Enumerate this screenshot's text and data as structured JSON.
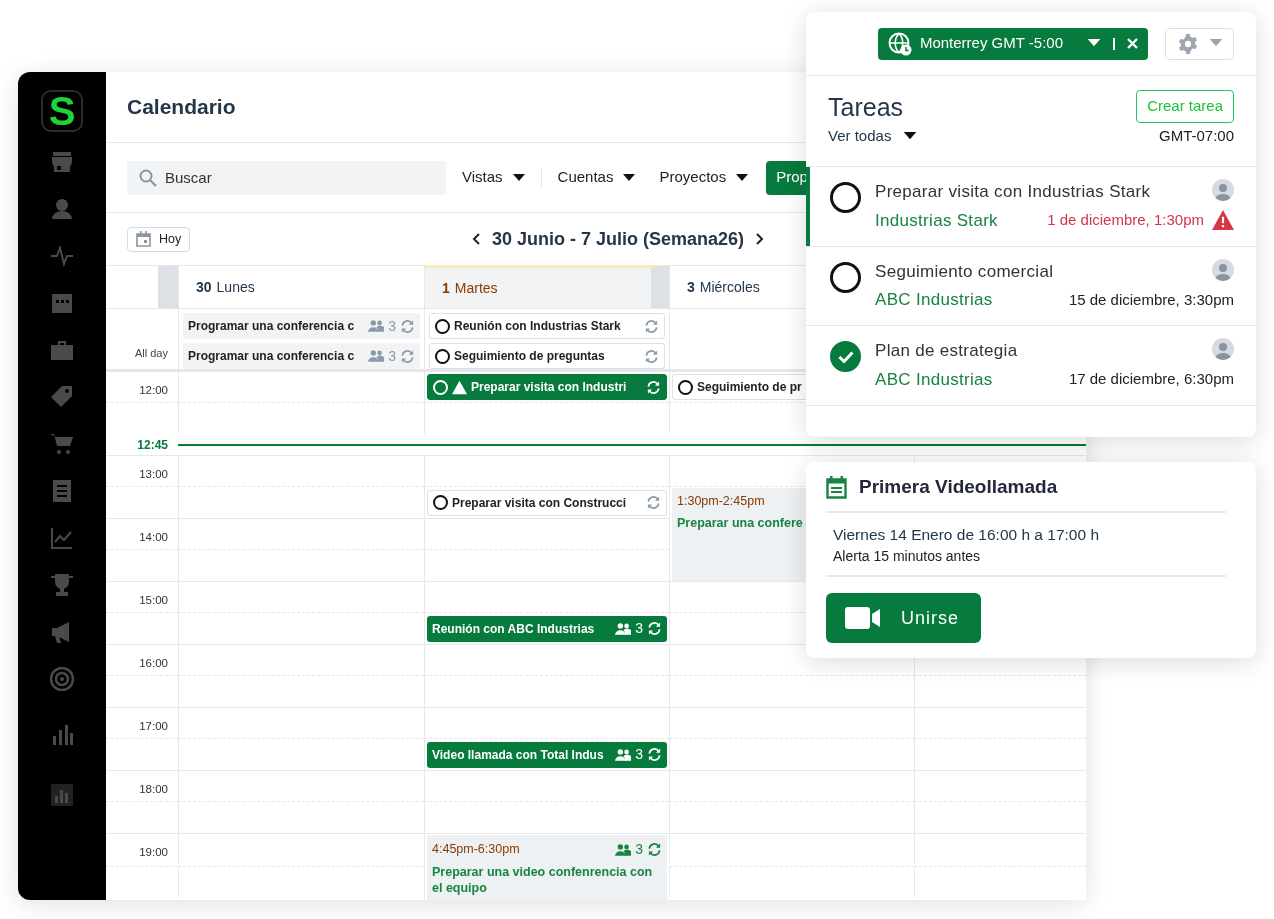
{
  "sidebar": {
    "logo": "S"
  },
  "header": {
    "title": "Calendario"
  },
  "toolbar": {
    "search": {
      "placeholder": "Buscar"
    },
    "filters": [
      "Vistas",
      "Cuentas",
      "Proyectos"
    ],
    "primary_button": "Prop"
  },
  "nav": {
    "today_button": "Hoy",
    "range": "30 Junio - 7 Julio (Semana26)"
  },
  "calendar": {
    "days": [
      {
        "number": "30",
        "name": "Lunes",
        "today": false
      },
      {
        "number": "1",
        "name": "Martes",
        "today": true
      },
      {
        "number": "3",
        "name": "Miércoles",
        "today": false
      }
    ],
    "all_day_label": "All day",
    "all_day": [
      [
        {
          "kind": "meeting",
          "title": "Programar una conferencia c",
          "highlighted": false,
          "attendees": "3",
          "recurring": true
        },
        {
          "kind": "meeting",
          "title": "Programar una conferencia c",
          "highlighted": false,
          "attendees": "3",
          "recurring": true
        }
      ],
      [
        {
          "kind": "task",
          "title": "Reunión con Industrias Stark",
          "checked": false,
          "highlighted": false,
          "warning": false,
          "recurring": true
        },
        {
          "kind": "task",
          "title": "Seguimiento de preguntas",
          "checked": false,
          "highlighted": false,
          "warning": false,
          "recurring": true
        }
      ]
    ],
    "rows": [
      {
        "kind": "hour",
        "time": "12:00",
        "cells": [
          [],
          [
            {
              "kind": "task",
              "title": "Preparar visita con Industri",
              "checked": false,
              "highlighted": true,
              "warning": true,
              "recurring": true
            }
          ],
          [
            {
              "kind": "task",
              "title": "Seguimiento de pr",
              "checked": false,
              "highlighted": false,
              "warning": false,
              "recurring": false
            }
          ]
        ]
      },
      {
        "kind": "half"
      },
      {
        "kind": "now",
        "time": "12:45"
      },
      {
        "kind": "hour",
        "time": "13:00"
      },
      {
        "kind": "half",
        "cells": [
          [],
          [
            {
              "kind": "task",
              "title": "Preparar visita con Construcci",
              "checked": false,
              "highlighted": false,
              "warning": false,
              "recurring": true
            }
          ],
          [
            {
              "kind": "block",
              "time_range": "1:30pm-2:45pm",
              "title": "Preparar una confere",
              "recurring": false
            }
          ]
        ]
      },
      {
        "kind": "hour",
        "time": "14:00"
      },
      {
        "kind": "half"
      },
      {
        "kind": "hour",
        "time": "15:00"
      },
      {
        "kind": "half",
        "cells": [
          [],
          [
            {
              "kind": "meeting",
              "title": "Reunión con ABC Industrias",
              "highlighted": true,
              "attendees": "3",
              "recurring": true
            }
          ]
        ]
      },
      {
        "kind": "hour",
        "time": "16:00"
      },
      {
        "kind": "half"
      },
      {
        "kind": "hour",
        "time": "17:00"
      },
      {
        "kind": "half",
        "cells": [
          [],
          [
            {
              "kind": "meeting",
              "title": "Video llamada con Total Indus",
              "highlighted": true,
              "attendees": "3",
              "recurring": true
            }
          ]
        ]
      },
      {
        "kind": "hour",
        "time": "18:00"
      },
      {
        "kind": "half"
      },
      {
        "kind": "hour",
        "time": "19:00",
        "cells": [
          [],
          [
            {
              "kind": "block",
              "time_range": "4:45pm-6:30pm",
              "title": "Preparar una video confenrencia con el equipo",
              "attendees": "3",
              "recurring": true
            }
          ]
        ]
      },
      {
        "kind": "half"
      }
    ]
  },
  "tasks_panel": {
    "timezone": "Monterrey GMT -5:00",
    "title": "Tareas",
    "create_button": "Crear tarea",
    "filter": "Ver todas",
    "gmt": "GMT-07:00",
    "tasks": [
      {
        "title": "Preparar visita con Industrias Stark",
        "company": "Industrias Stark",
        "due": "1 de diciembre, 1:30pm",
        "overdue": true,
        "checked": false,
        "selected": true
      },
      {
        "title": "Seguimiento comercial",
        "company": "ABC Industrias",
        "due": "15 de diciembre, 3:30pm",
        "overdue": false,
        "checked": false,
        "selected": false
      },
      {
        "title": "Plan de estrategia",
        "company": "ABC Industrias",
        "due": "17 de diciembre, 6:30pm",
        "overdue": false,
        "checked": true,
        "selected": false
      }
    ]
  },
  "event_popup": {
    "title": "Primera Videollamada",
    "when": "Viernes 14 Enero de 16:00 h a 17:00 h",
    "alert": "Alerta 15 minutos antes",
    "join_button": "Unirse"
  }
}
